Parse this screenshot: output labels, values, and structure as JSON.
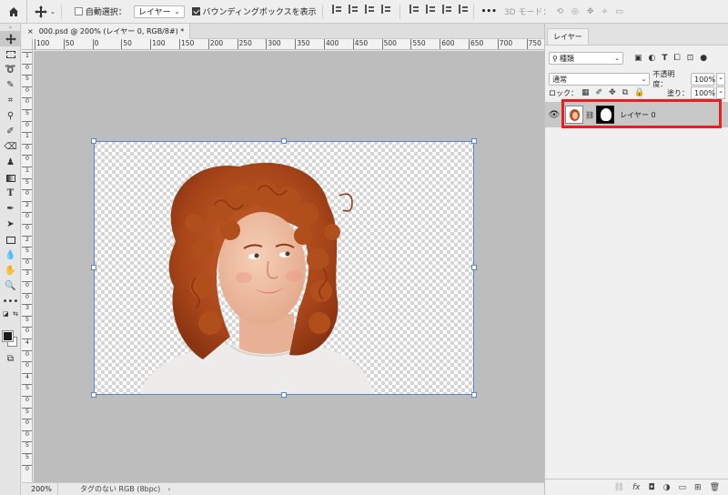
{
  "optionsbar": {
    "auto_select_label": "自動選択：",
    "auto_select_target": "レイヤー",
    "bounding_box_label": "バウンディングボックスを表示",
    "more": "•••",
    "mode_3d_label": "3D モード："
  },
  "document": {
    "tab_title": "000.psd @ 200% (レイヤー 0, RGB/8#) *",
    "close_glyph": "×"
  },
  "rulers": {
    "horizontal": [
      "100",
      "50",
      "0",
      "50",
      "100",
      "150",
      "200",
      "250",
      "300",
      "350",
      "400",
      "450",
      "500",
      "550",
      "600",
      "650",
      "700",
      "750"
    ],
    "vertical": [
      "1",
      "0",
      "5",
      "0",
      "0",
      "5",
      "0",
      "1",
      "0",
      "0",
      "1",
      "5",
      "0",
      "2",
      "0",
      "0",
      "2",
      "5",
      "0",
      "3",
      "0",
      "0",
      "3",
      "5",
      "0",
      "4",
      "0",
      "0",
      "4",
      "5",
      "0",
      "5",
      "0",
      "0",
      "5",
      "5",
      "0"
    ]
  },
  "status": {
    "zoom": "200%",
    "doc_info": "タグのない RGB (8bpc)",
    "arrow": "›"
  },
  "layers_panel": {
    "tab": "レイヤー",
    "filter_label": "種類",
    "blend_mode": "通常",
    "opacity_label": "不透明度：",
    "opacity_value": "100%",
    "lock_label": "ロック：",
    "fill_label": "塗り：",
    "fill_value": "100%",
    "layers": [
      {
        "name": "レイヤー 0",
        "visible": true
      }
    ]
  },
  "colors": {
    "accent_selection": "#5b86d6",
    "highlight_red": "#e22222",
    "hair": "#b8501e",
    "skin": "#f0c0a4"
  }
}
